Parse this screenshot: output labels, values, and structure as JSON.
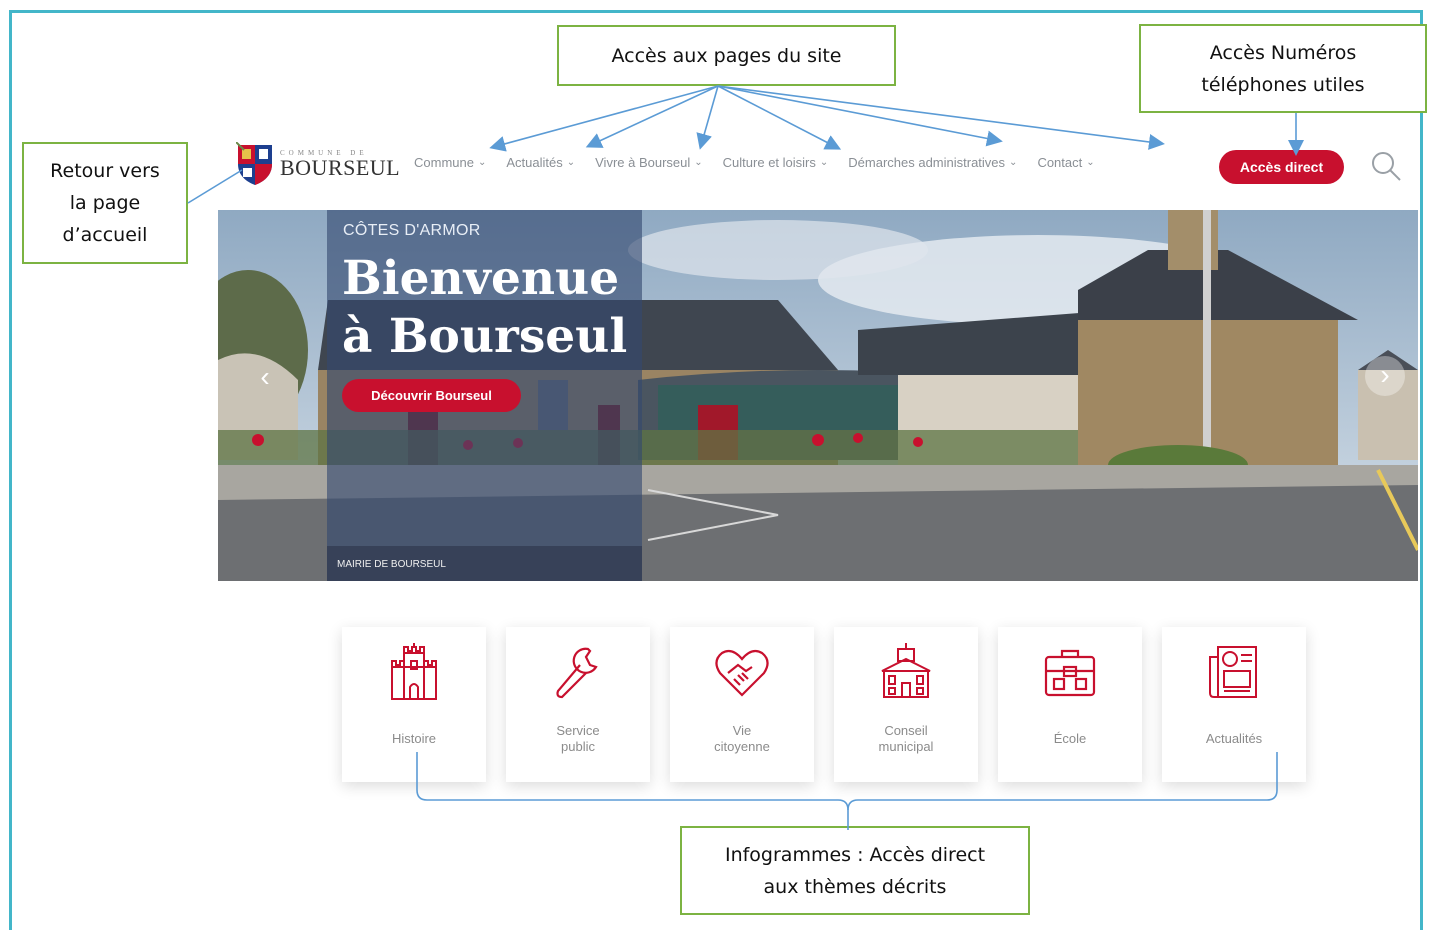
{
  "callouts": {
    "pages": "Accès aux pages du site",
    "phones": "Accès Numéros\ntéléphones utiles",
    "home": "Retour vers\nla page\nd’accueil",
    "infographics": "Infogrammes : Accès direct\naux thèmes décrits"
  },
  "header": {
    "logo_small": "COMMUNE DE",
    "logo_name": "BOURSEUL",
    "nav": [
      {
        "label": "Commune"
      },
      {
        "label": "Actualités"
      },
      {
        "label": "Vivre à Bourseul"
      },
      {
        "label": "Culture et loisirs"
      },
      {
        "label": "Démarches administratives"
      },
      {
        "label": "Contact"
      }
    ],
    "access_button": "Accès direct",
    "search_icon": "search-icon"
  },
  "hero": {
    "region": "CÔTES D'ARMOR",
    "title": "Bienvenue\nà Bourseul",
    "button": "Découvrir Bourseul",
    "caption": "MAIRIE DE BOURSEUL"
  },
  "tiles": [
    {
      "label": "Histoire",
      "icon": "castle-icon"
    },
    {
      "label": "Service\npublic",
      "icon": "wrench-icon"
    },
    {
      "label": "Vie\ncitoyenne",
      "icon": "handshake-heart-icon"
    },
    {
      "label": "Conseil\nmunicipal",
      "icon": "town-hall-icon"
    },
    {
      "label": "École",
      "icon": "school-bag-icon"
    },
    {
      "label": "Actualités",
      "icon": "newspaper-icon"
    }
  ],
  "colors": {
    "frame": "#43b6c9",
    "callout_border": "#7cb342",
    "accent_red": "#c8102e",
    "arrow_blue": "#5b9bd5"
  }
}
